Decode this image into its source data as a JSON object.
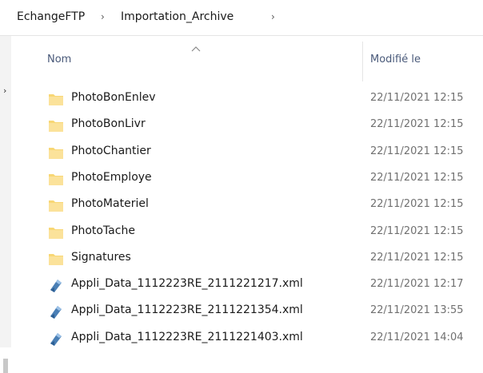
{
  "breadcrumb": {
    "items": [
      "EchangeFTP",
      "Importation_Archive"
    ],
    "separator": "›"
  },
  "columns": {
    "name": "Nom",
    "modified": "Modifié le"
  },
  "colors": {
    "folder": "#f8d775",
    "xml_file": "#4a7fb5"
  },
  "files": [
    {
      "name": "PhotoBonEnlev",
      "modified": "22/11/2021 12:15",
      "icon": "folder-icon"
    },
    {
      "name": "PhotoBonLivr",
      "modified": "22/11/2021 12:15",
      "icon": "folder-icon"
    },
    {
      "name": "PhotoChantier",
      "modified": "22/11/2021 12:15",
      "icon": "folder-icon"
    },
    {
      "name": "PhotoEmploye",
      "modified": "22/11/2021 12:15",
      "icon": "folder-icon"
    },
    {
      "name": "PhotoMateriel",
      "modified": "22/11/2021 12:15",
      "icon": "folder-icon"
    },
    {
      "name": "PhotoTache",
      "modified": "22/11/2021 12:15",
      "icon": "folder-icon"
    },
    {
      "name": "Signatures",
      "modified": "22/11/2021 12:15",
      "icon": "folder-icon"
    },
    {
      "name": "Appli_Data_1112223RE_2111221217.xml",
      "modified": "22/11/2021 12:17",
      "icon": "xml-file-icon"
    },
    {
      "name": "Appli_Data_1112223RE_2111221354.xml",
      "modified": "22/11/2021 13:55",
      "icon": "xml-file-icon"
    },
    {
      "name": "Appli_Data_1112223RE_2111221403.xml",
      "modified": "22/11/2021 14:04",
      "icon": "xml-file-icon"
    }
  ]
}
